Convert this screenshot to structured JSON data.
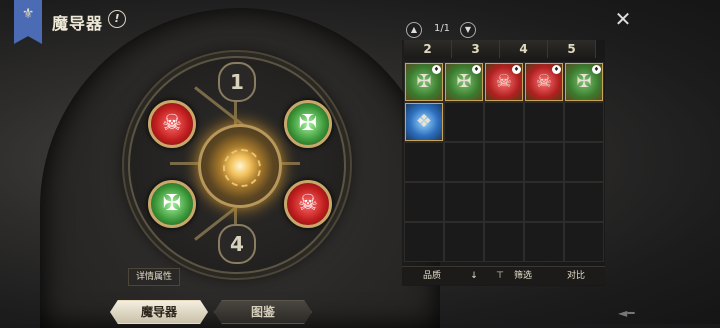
{
  "header": {
    "title": "魔导器",
    "info_glyph": "!",
    "banner_glyph": "⚜",
    "close_glyph": "✕"
  },
  "wheel": {
    "slot_top": "1",
    "slot_bottom": "4",
    "gems": [
      {
        "color": "red",
        "glyph": "☠"
      },
      {
        "color": "green",
        "glyph": "✠"
      },
      {
        "color": "green",
        "glyph": "✠"
      },
      {
        "color": "red",
        "glyph": "☠"
      }
    ],
    "detail_button": "详情属性"
  },
  "inventory": {
    "pager": {
      "prev": "▲",
      "text": "1/1",
      "next": "▼"
    },
    "columns": [
      "2",
      "3",
      "4",
      "5"
    ],
    "items": [
      {
        "color": "green",
        "glyph": "✠",
        "badge": true
      },
      {
        "color": "green",
        "glyph": "✠",
        "badge": true
      },
      {
        "color": "red",
        "glyph": "☠",
        "badge": true
      },
      {
        "color": "red",
        "glyph": "☠",
        "badge": true
      },
      {
        "color": "green",
        "glyph": "✠",
        "badge": true
      },
      {
        "color": "blue",
        "glyph": "❖",
        "badge": false
      }
    ],
    "bottom_bar": {
      "quality": "品质",
      "sort_icon": "↓",
      "filter_icon": "⊤",
      "filter": "筛选",
      "compare": "对比"
    }
  },
  "tabs": [
    {
      "label": "魔导器",
      "active": true
    },
    {
      "label": "图鉴",
      "active": false
    }
  ],
  "colors": {
    "banner": "#4b6bb5",
    "gold_frame": "#c8a76a"
  }
}
